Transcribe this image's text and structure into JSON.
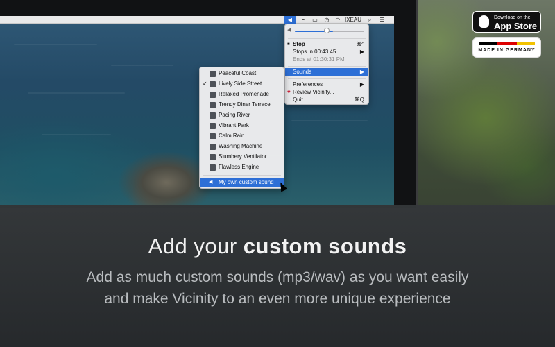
{
  "menubar": {
    "speaker_icon": "speaker-icon",
    "user_label": "IXEAU",
    "search_icon": "search-icon",
    "list_icon": "list-icon"
  },
  "vicinity_menu": {
    "volume_fraction": 0.55,
    "items": [
      {
        "label": "Stop",
        "shortcut": "⌘^",
        "bold": true
      },
      {
        "label": "Stops in 00:43.45",
        "shortcut": "▶"
      },
      {
        "label": "Ends at 01:30:31 PM",
        "disabled": true
      },
      {
        "label": "Sounds",
        "shortcut": "▶",
        "selected": true
      },
      {
        "label": "Preferences",
        "shortcut": "▶"
      },
      {
        "label": "Review Vicinity..."
      },
      {
        "label": "Quit",
        "shortcut": "⌘Q"
      }
    ]
  },
  "sounds_menu": {
    "items": [
      {
        "label": "Peaceful Coast",
        "icon": "coast-icon"
      },
      {
        "label": "Lively Side Street",
        "icon": "street-icon",
        "checked": true
      },
      {
        "label": "Relaxed Promenade",
        "icon": "promenade-icon"
      },
      {
        "label": "Trendy Diner Terrace",
        "icon": "diner-icon"
      },
      {
        "label": "Pacing River",
        "icon": "river-icon"
      },
      {
        "label": "Vibrant Park",
        "icon": "park-icon"
      },
      {
        "label": "Calm Rain",
        "icon": "rain-icon"
      },
      {
        "label": "Washing Machine",
        "icon": "washing-machine-icon"
      },
      {
        "label": "Slumbery Ventilator",
        "icon": "ventilator-icon"
      },
      {
        "label": "Flawless Engine",
        "icon": "engine-icon"
      },
      {
        "label": "My own custom sound",
        "icon": "speaker-icon",
        "selected": true
      }
    ]
  },
  "badges": {
    "appstore_small": "Download on the",
    "appstore_big": "App Store",
    "made_in": "MADE IN GERMANY"
  },
  "caption": {
    "headline_plain": "Add your ",
    "headline_bold": "custom sounds",
    "line1": "Add as much custom sounds (mp3/wav) as you want easily",
    "line2": "and make Vicinity to an even more unique experience"
  }
}
